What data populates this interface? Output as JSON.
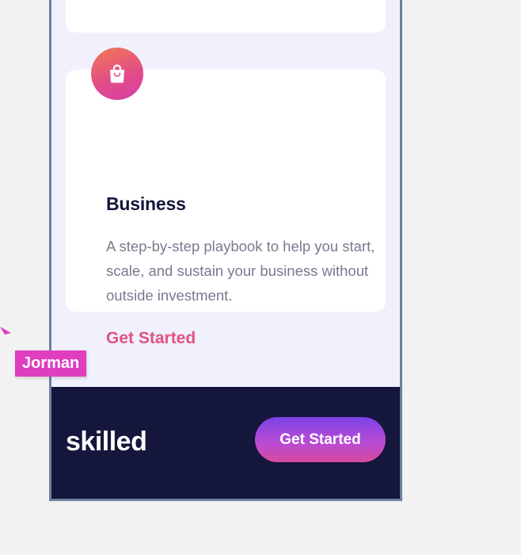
{
  "card": {
    "title": "Business",
    "description": "A step-by-step playbook to help you start, scale, and sustain your business without outside investment.",
    "link_label": "Get Started",
    "icon": "shopping-bag-icon"
  },
  "footer": {
    "logo": "skilled",
    "button_label": "Get Started"
  },
  "collaborator": {
    "name": "Jorman",
    "color": "#e03ec0"
  },
  "colors": {
    "page_bg": "#f0f1fd",
    "footer_bg": "#14163b",
    "link": "#e2527f",
    "heading": "#14163a",
    "body_text": "#777b8c"
  }
}
